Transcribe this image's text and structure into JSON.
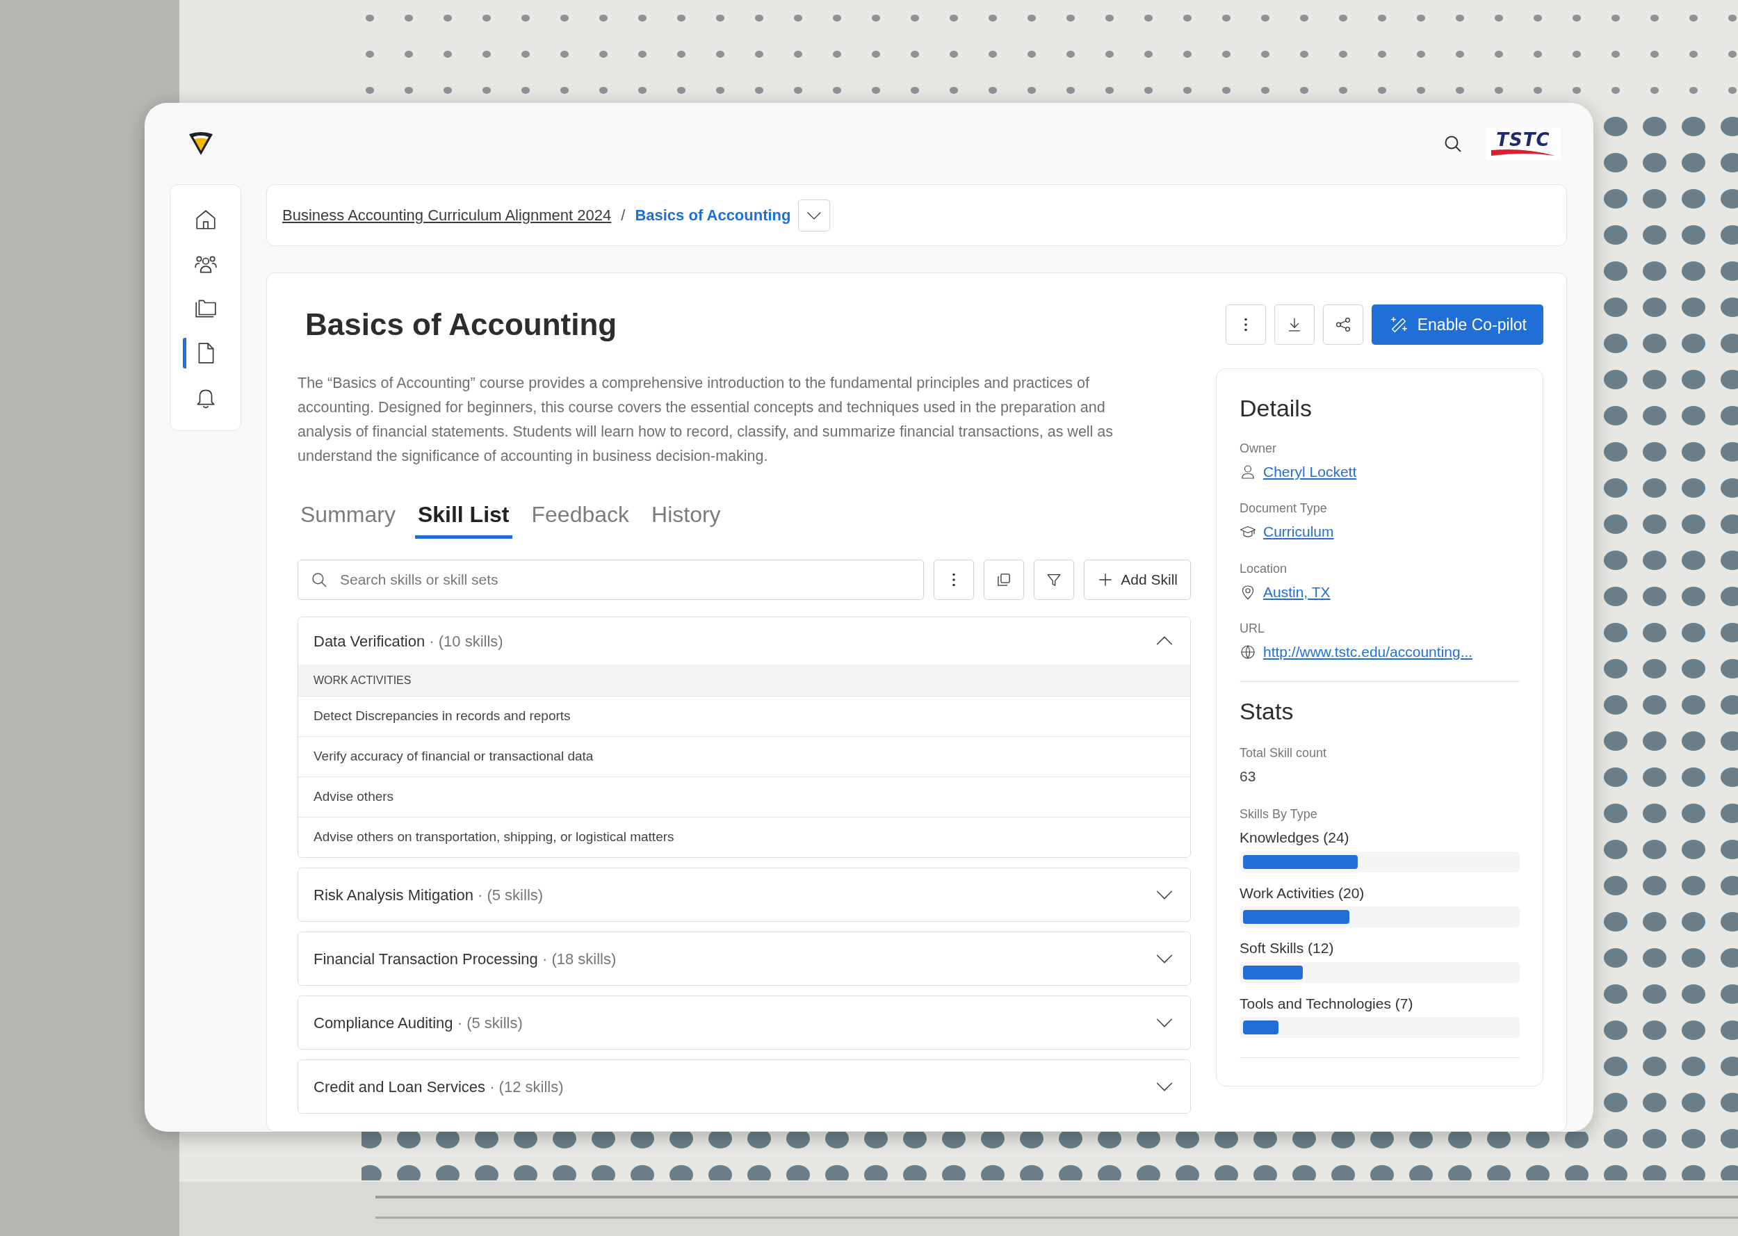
{
  "brand": {
    "logo_text": "TSTC"
  },
  "sidebar": {
    "items": [
      {
        "kind": "home",
        "selected": false
      },
      {
        "kind": "people",
        "selected": false
      },
      {
        "kind": "folder",
        "selected": false
      },
      {
        "kind": "document",
        "selected": true
      },
      {
        "kind": "bell",
        "selected": false
      }
    ]
  },
  "breadcrumb": {
    "separator": "/",
    "items": [
      {
        "label": "Business Accounting Curriculum Alignment 2024",
        "current": false
      },
      {
        "label": "Basics of Accounting",
        "current": true
      }
    ]
  },
  "page": {
    "title": "Basics of Accounting",
    "description": "The “Basics of Accounting” course provides a comprehensive introduction to the fundamental principles and practices of accounting. Designed for beginners, this course covers the essential concepts and techniques used in the preparation and analysis of financial statements. Students will learn how to record, classify, and summarize financial transactions, as well as understand the significance of accounting in business decision-making.",
    "actions": [
      {
        "kind": "more"
      },
      {
        "kind": "download"
      },
      {
        "kind": "share"
      },
      {
        "kind": "primary",
        "label": "Enable Co-pilot"
      }
    ]
  },
  "tabs": [
    {
      "label": "Summary",
      "selected": false
    },
    {
      "label": "Skill List",
      "selected": true
    },
    {
      "label": "Feedback",
      "selected": false
    },
    {
      "label": "History",
      "selected": false
    }
  ],
  "toolbar": {
    "search": {
      "placeholder": "Search skills or skill sets"
    },
    "buttons": [
      {
        "kind": "more"
      },
      {
        "kind": "copy"
      },
      {
        "kind": "filter"
      },
      {
        "kind": "add",
        "label": "Add Skill"
      }
    ]
  },
  "skill_groups": [
    {
      "name": "Data Verification",
      "count": "· (10 skills)",
      "expanded": true,
      "section": "WORK ACTIVITIES",
      "skills": [
        "Detect Discrepancies in records and reports",
        "Verify accuracy of financial or transactional data",
        "Advise others",
        "Advise others on transportation, shipping, or logistical matters"
      ]
    },
    {
      "name": "Risk Analysis Mitigation",
      "count": "· (5 skills)",
      "expanded": false
    },
    {
      "name": "Financial Transaction Processing",
      "count": "· (18 skills)",
      "expanded": false
    },
    {
      "name": "Compliance Auditing",
      "count": "· (5 skills)",
      "expanded": false
    },
    {
      "name": "Credit and Loan Services",
      "count": "· (12 skills)",
      "expanded": false
    }
  ],
  "details": {
    "title": "Details",
    "fields": [
      {
        "label": "Owner",
        "value": "Cheryl Lockett",
        "kind": "person"
      },
      {
        "label": "Document Type",
        "value": "Curriculum",
        "kind": "cap"
      },
      {
        "label": "Location",
        "value": "Austin, TX",
        "kind": "pin"
      },
      {
        "label": "URL",
        "value": "http://www.tstc.edu/accounting...",
        "kind": "globe"
      }
    ]
  },
  "stats": {
    "title": "Stats",
    "total_label": "Total Skill count",
    "total": "63",
    "by_type_label": "Skills By Type",
    "types": [
      {
        "label": "Knowledges (24)",
        "level": 0.42
      },
      {
        "label": "Work Activities (20)",
        "level": 0.39
      },
      {
        "label": "Soft Skills (12)",
        "level": 0.22
      },
      {
        "label": "Tools and Technologies (7)",
        "level": 0.13
      }
    ]
  }
}
